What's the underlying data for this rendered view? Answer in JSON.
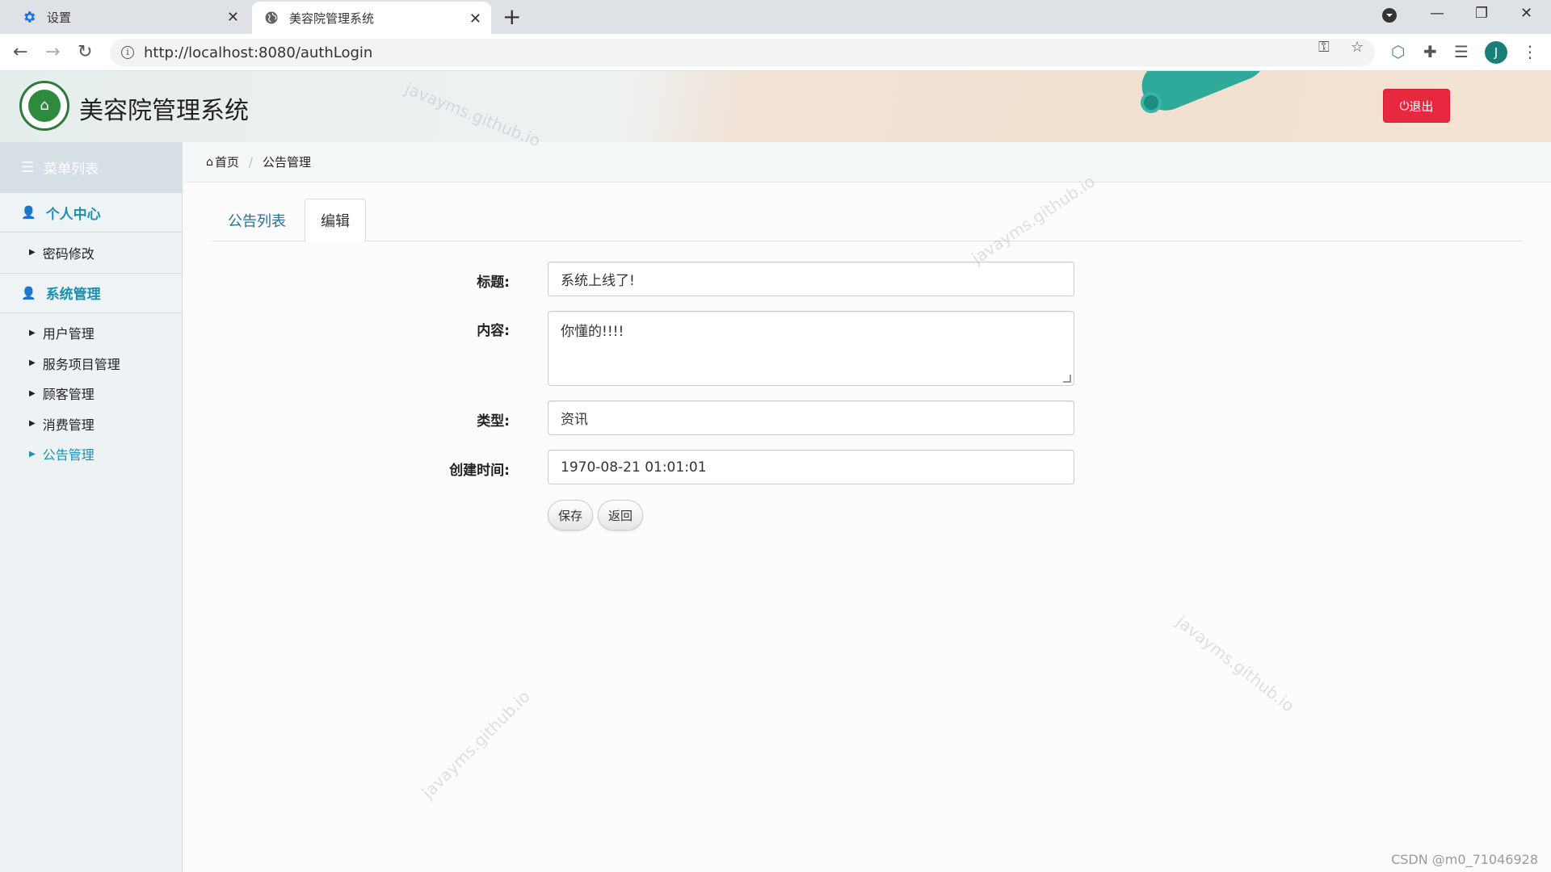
{
  "browser": {
    "tabs": [
      {
        "title": "设置",
        "icon": "gear-icon"
      },
      {
        "title": "美容院管理系统",
        "icon": "globe-icon"
      }
    ],
    "url": "http://localhost:8080/authLogin"
  },
  "header": {
    "title": "美容院管理系统",
    "logout_label": "退出",
    "logout_icon": "⏻"
  },
  "sidebar": {
    "heading": "菜单列表",
    "groups": [
      {
        "label": "个人中心",
        "items": [
          {
            "label": "密码修改"
          }
        ]
      },
      {
        "label": "系统管理",
        "items": [
          {
            "label": "用户管理"
          },
          {
            "label": "服务项目管理"
          },
          {
            "label": "顾客管理"
          },
          {
            "label": "消费管理"
          },
          {
            "label": "公告管理",
            "active": true
          }
        ]
      }
    ]
  },
  "breadcrumb": {
    "home": "首页",
    "current": "公告管理"
  },
  "tabs": {
    "list": "公告列表",
    "edit": "编辑"
  },
  "form": {
    "title_label": "标题:",
    "title_value": "系统上线了!",
    "content_label": "内容:",
    "content_value": "你懂的!!!!",
    "type_label": "类型:",
    "type_value": "资讯",
    "created_label": "创建时间:",
    "created_value": "1970-08-21 01:01:01",
    "save_label": "保存",
    "back_label": "返回"
  },
  "watermark": "javayms.github.io",
  "footer_credit": "CSDN @m0_71046928",
  "colors": {
    "accent": "#1d8fb0",
    "danger": "#e8283f"
  }
}
